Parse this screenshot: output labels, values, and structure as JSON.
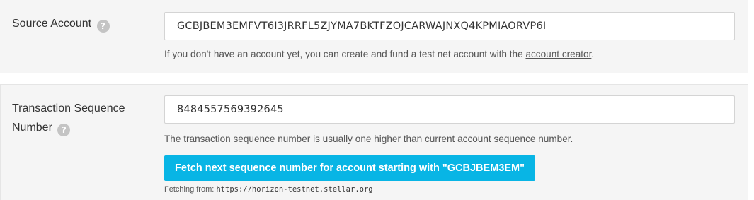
{
  "source_account": {
    "label": "Source Account",
    "help_glyph": "?",
    "value": "GCBJBEM3EMFVT6I3JRRFL5ZJYMA7BKTFZOJCARWAJNXQ4KPMIAORVP6I",
    "hint_prefix": "If you don't have an account yet, you can create and fund a test net account with the ",
    "hint_link": "account creator",
    "hint_suffix": "."
  },
  "sequence": {
    "label_line1": "Transaction Sequence",
    "label_line2": "Number",
    "help_glyph": "?",
    "value": "8484557569392645",
    "hint": "The transaction sequence number is usually one higher than current account sequence number.",
    "fetch_button": "Fetch next sequence number for account starting with \"GCBJBEM3EM\"",
    "fetching_label": "Fetching from: ",
    "fetching_url": "https://horizon-testnet.stellar.org"
  },
  "colors": {
    "panel_bg": "#f5f5f5",
    "button_bg": "#08b5e5",
    "help_icon_bg": "#c4c4c4"
  },
  "icons": {
    "help": "question-mark-icon"
  }
}
